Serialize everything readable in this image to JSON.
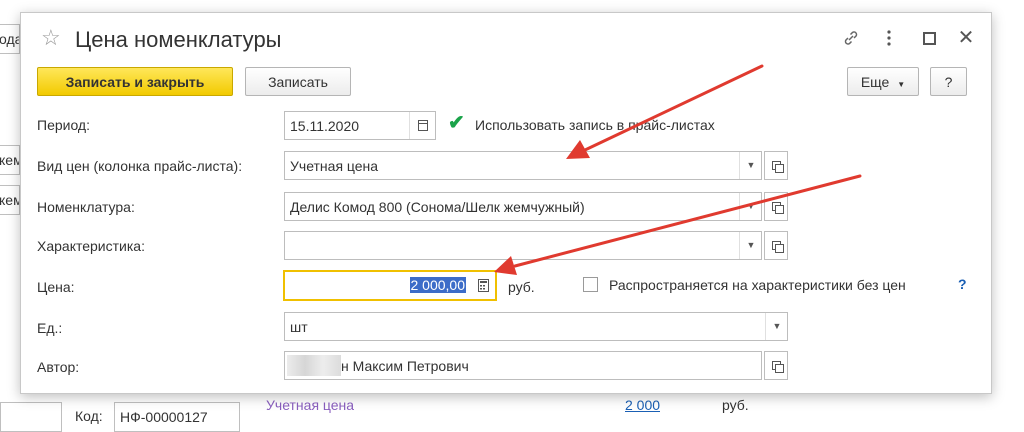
{
  "background": {
    "left_fragments": [
      "ода",
      "кем",
      "кем"
    ],
    "code_label": "Код:",
    "code_value": "НФ-00000127",
    "price_type_link": "Учетная цена",
    "price_link": "2 000",
    "price_currency": "руб."
  },
  "dialog": {
    "title": "Цена номенклатуры",
    "buttons": {
      "save_close": "Записать и закрыть",
      "save": "Записать",
      "more": "Еще",
      "help": "?"
    },
    "fields": {
      "period": {
        "label": "Период:",
        "value": "15.11.2020"
      },
      "use_in_pricelists": {
        "label": "Использовать запись в прайс-листах",
        "checked": true
      },
      "price_type": {
        "label": "Вид цен  (колонка прайс-листа):",
        "value": "Учетная цена"
      },
      "nomenclature": {
        "label": "Номенклатура:",
        "value": "Делис Комод 800 (Сонома/Шелк жемчужный)"
      },
      "characteristic": {
        "label": "Характеристика:",
        "value": ""
      },
      "price": {
        "label": "Цена:",
        "value": "2 000,00",
        "currency": "руб."
      },
      "applies_to_characteristics": {
        "label": "Распространяется на характеристики без цен",
        "checked": false,
        "help": "?"
      },
      "unit": {
        "label": "Ед.:",
        "value": "шт"
      },
      "author": {
        "label": "Автор:",
        "value": "н Максим Петрович"
      }
    }
  },
  "colors": {
    "primary_button": "#f2ca00",
    "checkmark": "#1aa34a",
    "focus_border": "#f0c000",
    "selection": "#3c6cc8",
    "arrow": "#e03a2f",
    "link_blue": "#1a5fb4",
    "link_violet": "#8a5fbf"
  }
}
